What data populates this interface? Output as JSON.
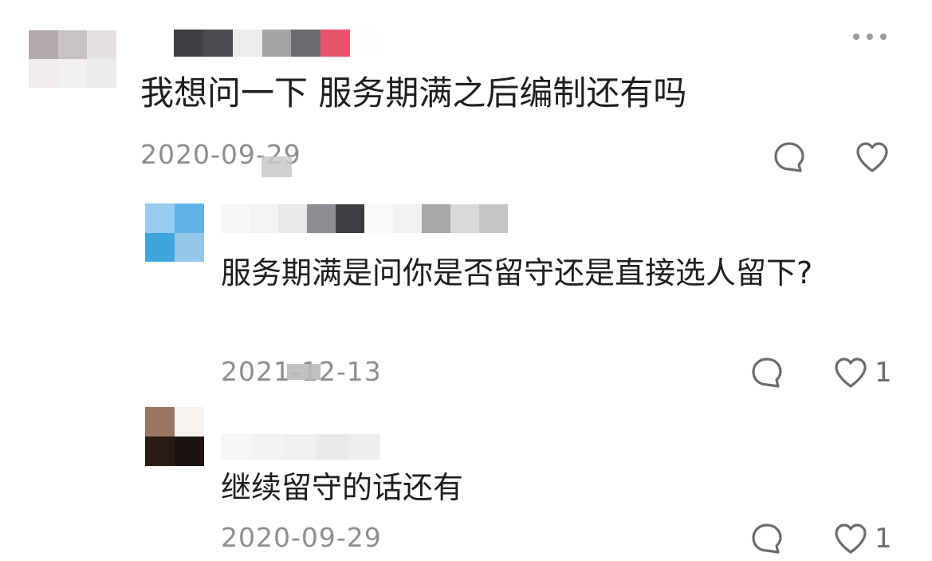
{
  "main_comment": {
    "text": "我想问一下 服务期满之后编制还有吗",
    "date": "2020-09-29",
    "avatar_mosaic": [
      "#b3a9ab",
      "#c7c2c3",
      "#e6e0e2",
      "#f0eced",
      "#f1f0ef",
      "#ecebeb"
    ],
    "name_mosaic": [
      "#3d3f45",
      "#4a4b4f",
      "#ececed",
      "#a4a3a5",
      "#6a6b6e",
      "#e9536e",
      "#fefefe"
    ],
    "more_icon": "more-horizontal-icon",
    "reply_icon": "comment-bubble-icon",
    "like_icon": "heart-outline-icon"
  },
  "replies": [
    {
      "text": "服务期满是问你是否留守还是直接选人留下?",
      "date": "2021-12-13",
      "likes": "1",
      "avatar_mosaic": [
        "#97cbef",
        "#5eb2e8",
        "#3ea4dd",
        "#95c7ea"
      ],
      "name_mosaic": [
        "#f7f7f7",
        "#f3f3f3",
        "#e8e8e8",
        "#8e8f95",
        "#3c3d41",
        "#f9f9f9",
        "#f2f2f2",
        "#a8a8aa",
        "#d9d9da",
        "#c5c5c6"
      ],
      "reply_icon": "comment-bubble-icon",
      "like_icon": "heart-outline-icon"
    },
    {
      "text": "继续留守的话还有",
      "date": "2020-09-29",
      "likes": "1",
      "avatar_mosaic": [
        "#9c7562",
        "#f5f2f0",
        "#2a1b14",
        "#1c1410"
      ],
      "name_mosaic": [
        "#f6f6f6",
        "#f2f2f2",
        "#efefef",
        "#e9e9e9",
        "#eeeeee"
      ],
      "reply_icon": "comment-bubble-icon",
      "like_icon": "heart-outline-icon"
    }
  ],
  "colors": {
    "text": "#1e1e1e",
    "meta": "#8e8e8e",
    "icon": "#6c6c6c"
  }
}
